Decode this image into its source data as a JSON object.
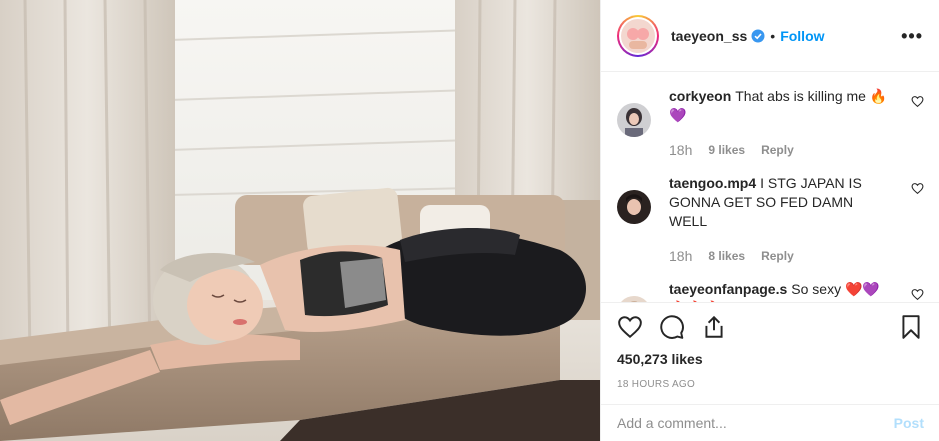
{
  "post": {
    "username": "taeyeon_ss",
    "verified": true,
    "dot": "•",
    "follow_label": "Follow",
    "more_label": "•••",
    "icons": {
      "avatar": "profile-avatar",
      "verified": "verified-badge-icon",
      "more": "more-options-icon",
      "like": "heart-icon",
      "comment": "comment-icon",
      "share": "share-icon",
      "save": "bookmark-icon"
    },
    "likes": "450,273 likes",
    "timestamp": "18 HOURS AGO",
    "comment_placeholder": "Add a comment...",
    "post_label": "Post"
  },
  "comments": [
    {
      "user": "corkyeon",
      "text": "That abs is killing me 🔥💜",
      "time": "18h",
      "likes": "9 likes",
      "reply": "Reply"
    },
    {
      "user": "taengoo.mp4",
      "text": "I STG JAPAN IS GONNA GET SO FED DAMN WELL",
      "time": "18h",
      "likes": "8 likes",
      "reply": "Reply"
    },
    {
      "user": "taeyeonfanpage.s",
      "text": "So sexy ❤️💜 🔥🔥🔥",
      "time": "",
      "likes": "",
      "reply": ""
    }
  ],
  "colors": {
    "accent": "#0095f6",
    "post_disabled": "#b2dffc",
    "text": "#262626",
    "muted": "#8e8e8e"
  }
}
